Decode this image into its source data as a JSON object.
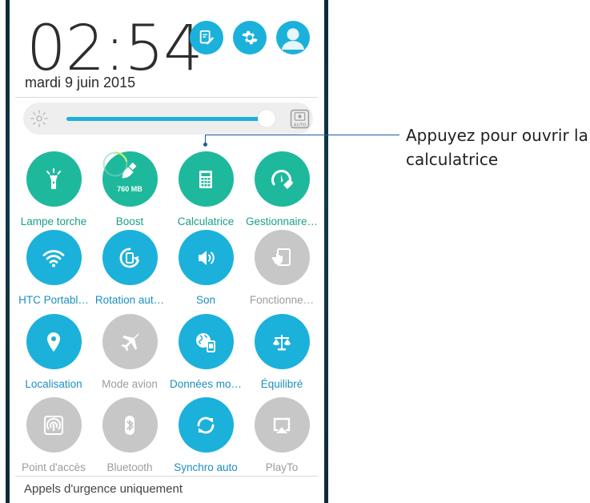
{
  "status": {
    "time": "02:54",
    "date": "mardi 9 juin 2015"
  },
  "header_buttons": [
    {
      "icon": "edit-icon"
    },
    {
      "icon": "gear-icon"
    },
    {
      "icon": "avatar-icon"
    }
  ],
  "brightness": {
    "level_percent": 92,
    "auto_label": "AUTO"
  },
  "tiles": [
    {
      "label": "Lampe torche",
      "icon": "flashlight-icon",
      "state": "green"
    },
    {
      "label": "Boost",
      "icon": "broom-icon",
      "state": "green",
      "badge": "760 MB"
    },
    {
      "label": "Calculatrice",
      "icon": "calculator-icon",
      "state": "green"
    },
    {
      "label": "Gestionnaire…",
      "icon": "gauge-wrench-icon",
      "state": "green"
    },
    {
      "label": "HTC Portabl…",
      "icon": "wifi-icon",
      "state": "blue"
    },
    {
      "label": "Rotation aut…",
      "icon": "rotation-icon",
      "state": "blue"
    },
    {
      "label": "Son",
      "icon": "speaker-icon",
      "state": "blue"
    },
    {
      "label": "Fonctionne…",
      "icon": "touch-icon",
      "state": "gray"
    },
    {
      "label": "Localisation",
      "icon": "location-pin-icon",
      "state": "blue"
    },
    {
      "label": "Mode avion",
      "icon": "airplane-icon",
      "state": "gray"
    },
    {
      "label": "Données mo…",
      "icon": "globe-data-icon",
      "state": "blue"
    },
    {
      "label": "Équilibré",
      "icon": "balance-icon",
      "state": "blue"
    },
    {
      "label": "Point d'accès",
      "icon": "hotspot-icon",
      "state": "gray"
    },
    {
      "label": "Bluetooth",
      "icon": "bluetooth-icon",
      "state": "gray"
    },
    {
      "label": "Synchro auto",
      "icon": "sync-icon",
      "state": "blue"
    },
    {
      "label": "PlayTo",
      "icon": "cast-icon",
      "state": "gray"
    }
  ],
  "footer": "Appels d'urgence uniquement",
  "callout": {
    "line1": "Appuyez pour ouvrir la",
    "line2": "calculatrice"
  },
  "colors": {
    "green": "#1eb99c",
    "blue": "#1bb1db",
    "gray": "#c7c7c7"
  }
}
